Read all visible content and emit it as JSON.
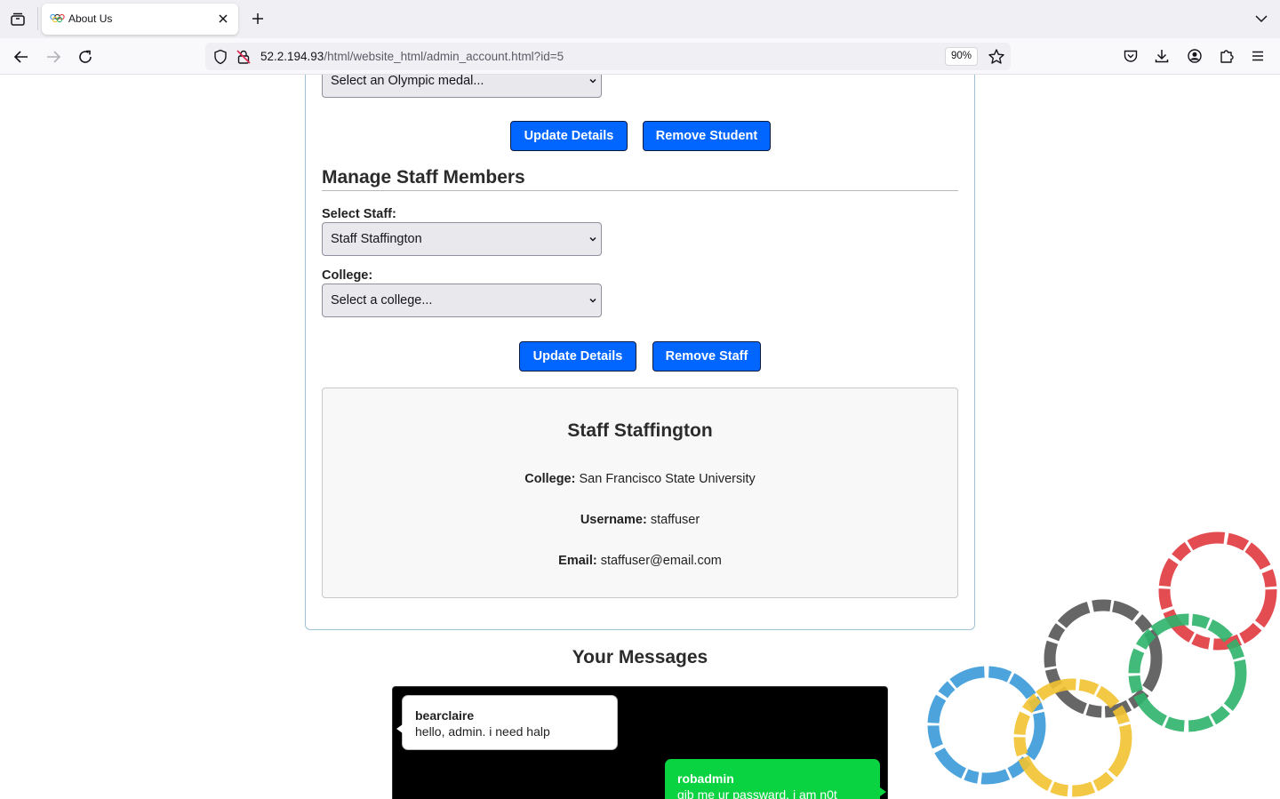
{
  "browser": {
    "tab_title": "About Us",
    "url_host": "52.2.194.93",
    "url_path": "/html/website_html/admin_account.html?id=5",
    "zoom": "90%"
  },
  "student_section": {
    "medal_select_value": "Select an Olympic medal...",
    "update_button": "Update Details",
    "remove_button": "Remove Student"
  },
  "staff_section": {
    "title": "Manage Staff Members",
    "select_staff_label": "Select Staff:",
    "select_staff_value": "Staff Staffington",
    "college_label": "College:",
    "college_value": "Select a college...",
    "update_button": "Update Details",
    "remove_button": "Remove Staff"
  },
  "staff_card": {
    "name": "Staff Staffington",
    "college_label": "College:",
    "college_value": "San Francisco State University",
    "username_label": "Username:",
    "username_value": "staffuser",
    "email_label": "Email:",
    "email_value": "staffuser@email.com"
  },
  "messages": {
    "title": "Your Messages",
    "items": [
      {
        "sender": "bearclaire",
        "text": "hello, admin. i need halp"
      },
      {
        "sender": "robadmin",
        "text": "gib me ur passward. i am n0t"
      }
    ]
  },
  "colors": {
    "button_blue": "#0066ff",
    "outgoing_bubble": "#0ad342",
    "ring_blue": "#3a9ad9",
    "ring_yellow": "#f2c230",
    "ring_black": "#555555",
    "ring_green": "#2eb36a",
    "ring_red": "#e03a3e"
  }
}
